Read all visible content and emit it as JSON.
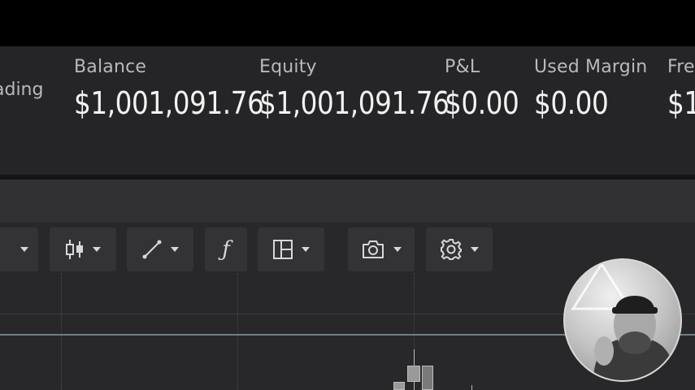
{
  "account": {
    "partial_label": "ading",
    "stats": [
      {
        "label": "Balance",
        "value": "$1,001,091.76"
      },
      {
        "label": "Equity",
        "value": "$1,001,091.76"
      },
      {
        "label": "P&L",
        "value": "$0.00"
      },
      {
        "label": "Used Margin",
        "value": "$0.00"
      },
      {
        "label": "Fre",
        "value": "$1"
      }
    ]
  },
  "toolbar": {
    "function_glyph": "ƒ",
    "tools": [
      {
        "icon": "partial-dropdown-icon"
      },
      {
        "icon": "candlestick-icon"
      },
      {
        "icon": "trendline-icon"
      },
      {
        "icon": "function-icon"
      },
      {
        "icon": "layout-icon"
      },
      {
        "icon": "camera-icon"
      },
      {
        "icon": "gear-icon"
      }
    ]
  },
  "webcam": {
    "icon": "webcam-overlay"
  }
}
